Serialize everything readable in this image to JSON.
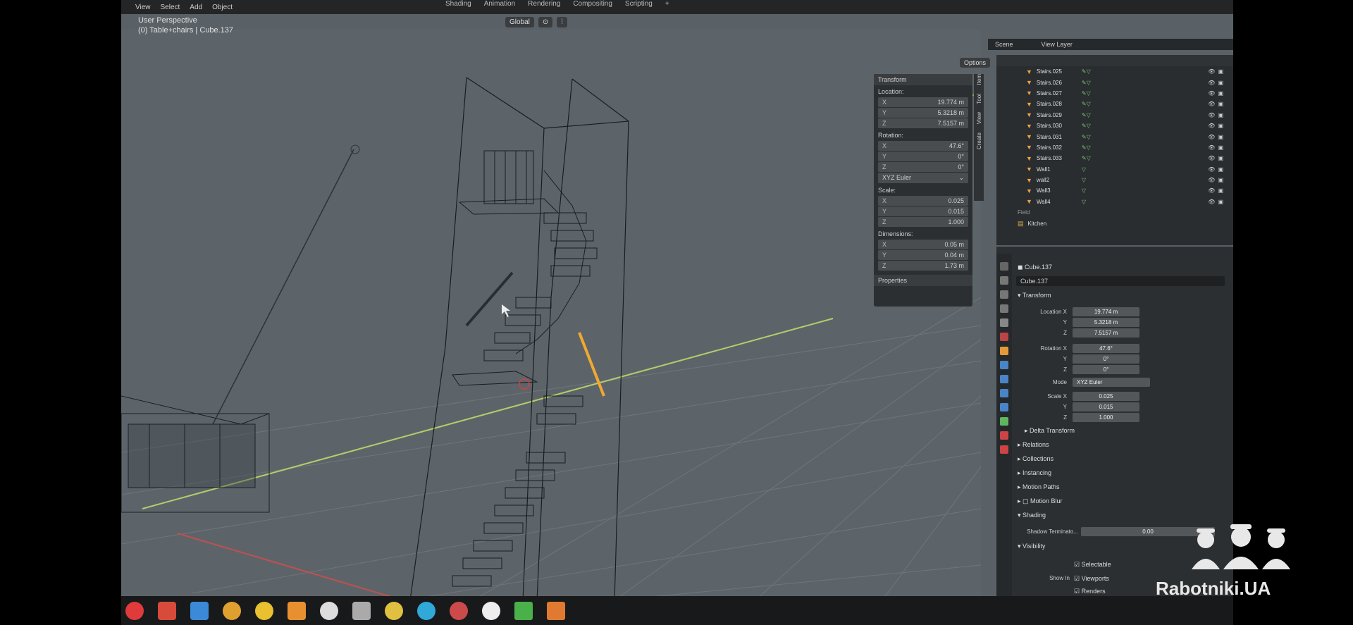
{
  "topbar": {
    "menu": [
      "View",
      "Select",
      "Add",
      "Object"
    ],
    "workspaces": [
      "Shading",
      "Animation",
      "Rendering",
      "Compositing",
      "Scripting"
    ]
  },
  "viewport": {
    "mode": "User Perspective",
    "collection": "(0) Table+chairs | Cube.137",
    "orientation": "Global",
    "options": "Options"
  },
  "npanel": {
    "header": "Transform",
    "location_label": "Location:",
    "location": [
      {
        "axis": "X",
        "value": "19.774 m"
      },
      {
        "axis": "Y",
        "value": "5.3218 m"
      },
      {
        "axis": "Z",
        "value": "7.5157 m"
      }
    ],
    "rotation_label": "Rotation:",
    "rotation": [
      {
        "axis": "X",
        "value": "47.6°"
      },
      {
        "axis": "Y",
        "value": "0°"
      },
      {
        "axis": "Z",
        "value": "0°"
      }
    ],
    "rotation_mode": "XYZ Euler",
    "scale_label": "Scale:",
    "scale": [
      {
        "axis": "X",
        "value": "0.025"
      },
      {
        "axis": "Y",
        "value": "0.015"
      },
      {
        "axis": "Z",
        "value": "1.000"
      }
    ],
    "dimensions_label": "Dimensions:",
    "dimensions": [
      {
        "axis": "X",
        "value": "0.05 m"
      },
      {
        "axis": "Y",
        "value": "0.04 m"
      },
      {
        "axis": "Z",
        "value": "1.73 m"
      }
    ],
    "properties": "Properties",
    "tabs": [
      "Item",
      "Tool",
      "View",
      "Create"
    ]
  },
  "scene_bar": {
    "scene": "Scene",
    "view_layer": "View Layer"
  },
  "outliner": {
    "items": [
      "Stairs.025",
      "Stairs.026",
      "Stairs.027",
      "Stairs.028",
      "Stairs.029",
      "Stairs.030",
      "Stairs.031",
      "Stairs.032",
      "Stairs.033",
      "Wall1",
      "wall2",
      "Wall3",
      "Wall4"
    ],
    "field": "Field",
    "kitchen": "Kitchen"
  },
  "properties": {
    "object_name": "Cube.137",
    "data_name": "Cube.137",
    "transform": "Transform",
    "location_x_label": "Location X",
    "location": [
      "19.774 m",
      "5.3218 m",
      "7.5157 m"
    ],
    "rotation_x_label": "Rotation X",
    "rotation": [
      "47.6°",
      "0°",
      "0°"
    ],
    "mode_label": "Mode",
    "mode": "XYZ Euler",
    "scale_x_label": "Scale X",
    "scale": [
      "0.025",
      "0.015",
      "1.000"
    ],
    "axis_y": "Y",
    "axis_z": "Z",
    "sections": [
      "Delta Transform",
      "Relations",
      "Collections",
      "Instancing",
      "Motion Paths",
      "Motion Blur",
      "Shading"
    ],
    "shadow_label": "Shadow Terminato...",
    "shadow_value": "0.00",
    "visibility": "Visibility",
    "selectable": "Selectable",
    "show_in": "Show In",
    "viewports": "Viewports",
    "renders": "Renders"
  },
  "watermark": "Rabotniki.UA"
}
